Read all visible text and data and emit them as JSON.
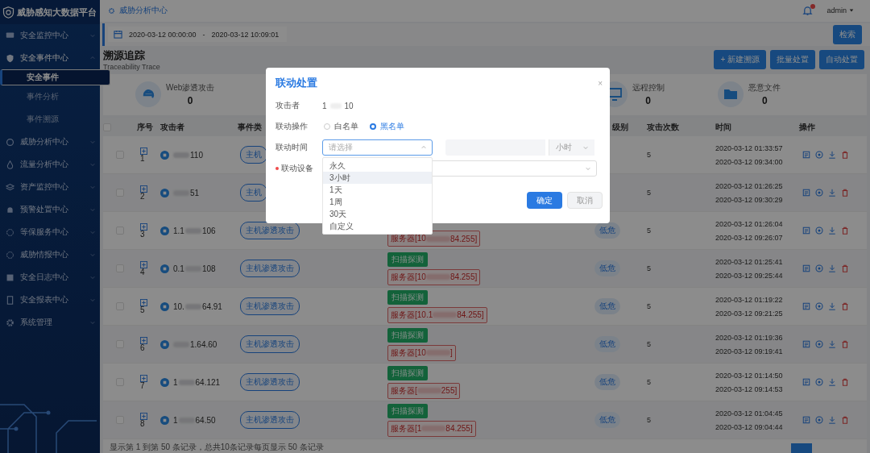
{
  "app": {
    "title": "威胁感知大数据平台"
  },
  "sidebar": {
    "items": [
      {
        "label": "安全监控中心",
        "expanded": false
      },
      {
        "label": "安全事件中心",
        "expanded": true,
        "children": [
          {
            "label": "安全事件",
            "selected": true
          },
          {
            "label": "事件分析",
            "selected": false
          },
          {
            "label": "事件溯源",
            "selected": false
          }
        ]
      },
      {
        "label": "威胁分析中心",
        "expanded": false
      },
      {
        "label": "流量分析中心",
        "expanded": false
      },
      {
        "label": "资产监控中心",
        "expanded": false
      },
      {
        "label": "预警处置中心",
        "expanded": false
      },
      {
        "label": "等保服务中心",
        "expanded": false
      },
      {
        "label": "威胁情报中心",
        "expanded": false
      },
      {
        "label": "安全日志中心",
        "expanded": false
      },
      {
        "label": "安全报表中心",
        "expanded": false
      },
      {
        "label": "系统管理",
        "expanded": false
      }
    ]
  },
  "breadcrumb": "威胁分析中心",
  "user": "admin",
  "date_range": {
    "start": "2020-03-12 00:00:00",
    "separator": "-",
    "end": "2020-03-12 10:09:01"
  },
  "search_button": "检索",
  "page_title": "溯源追踪",
  "page_subtitle": "Traceability Trace",
  "actions": [
    "+ 新建溯源",
    "批量处置",
    "自动处置"
  ],
  "stats": [
    {
      "label": "Web渗透攻击",
      "value": "0"
    },
    {
      "label": "远程控制",
      "value": "0"
    },
    {
      "label": "恶意文件",
      "value": "0"
    }
  ],
  "table": {
    "all_checked": false,
    "columns": [
      "序号",
      "攻击者",
      "事件类",
      "级别",
      "攻击次数",
      "时间",
      "操作"
    ],
    "rows": [
      {
        "checked": false,
        "index": "1",
        "attacker_prefix": "",
        "attacker_suffix": "110",
        "event_type": "主机",
        "scan_tag": null,
        "target_prefix": null,
        "target_suffix": null,
        "level": null,
        "count": "5",
        "first_time": "2020-03-12 01:33:57",
        "last_time": "2020-03-12 09:34:00"
      },
      {
        "checked": false,
        "index": "2",
        "attacker_prefix": "",
        "attacker_suffix": "51",
        "event_type": "主机",
        "scan_tag": null,
        "target_prefix": null,
        "target_suffix": null,
        "level": null,
        "count": "5",
        "first_time": "2020-03-12 01:26:25",
        "last_time": "2020-03-12 09:30:29"
      },
      {
        "checked": false,
        "index": "3",
        "attacker_prefix": "1.1",
        "attacker_suffix": "106",
        "event_type": "主机渗透攻击",
        "scan_tag": null,
        "target_prefix": "服务器[10",
        "target_suffix": "84.255]",
        "level": "低危",
        "count": "5",
        "first_time": "2020-03-12 01:26:04",
        "last_time": "2020-03-12 09:26:07"
      },
      {
        "checked": false,
        "index": "4",
        "attacker_prefix": "0.1",
        "attacker_suffix": "108",
        "event_type": "主机渗透攻击",
        "scan_tag": "扫描探测",
        "target_prefix": "服务器[10",
        "target_suffix": "84.255]",
        "level": "低危",
        "count": "5",
        "first_time": "2020-03-12 01:25:41",
        "last_time": "2020-03-12 09:25:44"
      },
      {
        "checked": false,
        "index": "5",
        "attacker_prefix": "10.",
        "attacker_suffix": "64.91",
        "event_type": "主机渗透攻击",
        "scan_tag": "扫描探测",
        "target_prefix": "服务器[10.1",
        "target_suffix": "84.255]",
        "level": "低危",
        "count": "5",
        "first_time": "2020-03-12 01:19:22",
        "last_time": "2020-03-12 09:21:25"
      },
      {
        "checked": false,
        "index": "6",
        "attacker_prefix": "",
        "attacker_suffix": "1.64.60",
        "event_type": "主机渗透攻击",
        "scan_tag": "扫描探测",
        "target_prefix": "服务器[10",
        "target_suffix": "]",
        "level": "低危",
        "count": "5",
        "first_time": "2020-03-12 01:19:36",
        "last_time": "2020-03-12 09:19:41"
      },
      {
        "checked": false,
        "index": "7",
        "attacker_prefix": "1",
        "attacker_suffix": "64.121",
        "event_type": "主机渗透攻击",
        "scan_tag": "扫描探测",
        "target_prefix": "服务器[",
        "target_suffix": "255]",
        "level": "低危",
        "count": "5",
        "first_time": "2020-03-12 01:14:50",
        "last_time": "2020-03-12 09:14:53"
      },
      {
        "checked": false,
        "index": "8",
        "attacker_prefix": "1",
        "attacker_suffix": "64.50",
        "event_type": "主机渗透攻击",
        "scan_tag": "扫描探测",
        "target_prefix": "服务器[1",
        "target_suffix": "84.255]",
        "level": "低危",
        "count": "5",
        "first_time": "2020-03-12 01:04:45",
        "last_time": "2020-03-12 09:04:44"
      }
    ]
  },
  "footer": "显示第 1 到第 50 条记录，总共10条记录每页显示  50  条记录",
  "dialog": {
    "title": "联动处置",
    "close": "×",
    "attacker_label": "攻击者",
    "attacker_prefix": "1",
    "attacker_suffix": "10",
    "operation_label": "联动操作",
    "operations": [
      {
        "label": "白名单",
        "selected": false
      },
      {
        "label": "黑名单",
        "selected": true
      }
    ],
    "time_label": "联动时间",
    "time_placeholder": "请选择",
    "time_unit": "小时",
    "device_label": "联动设备",
    "device_required": true,
    "time_options": [
      {
        "label": "永久",
        "hovered": false
      },
      {
        "label": "3小时",
        "hovered": true
      },
      {
        "label": "1天",
        "hovered": false
      },
      {
        "label": "1周",
        "hovered": false
      },
      {
        "label": "30天",
        "hovered": false
      },
      {
        "label": "自定义",
        "hovered": false
      }
    ],
    "confirm": "确定",
    "cancel": "取消"
  }
}
